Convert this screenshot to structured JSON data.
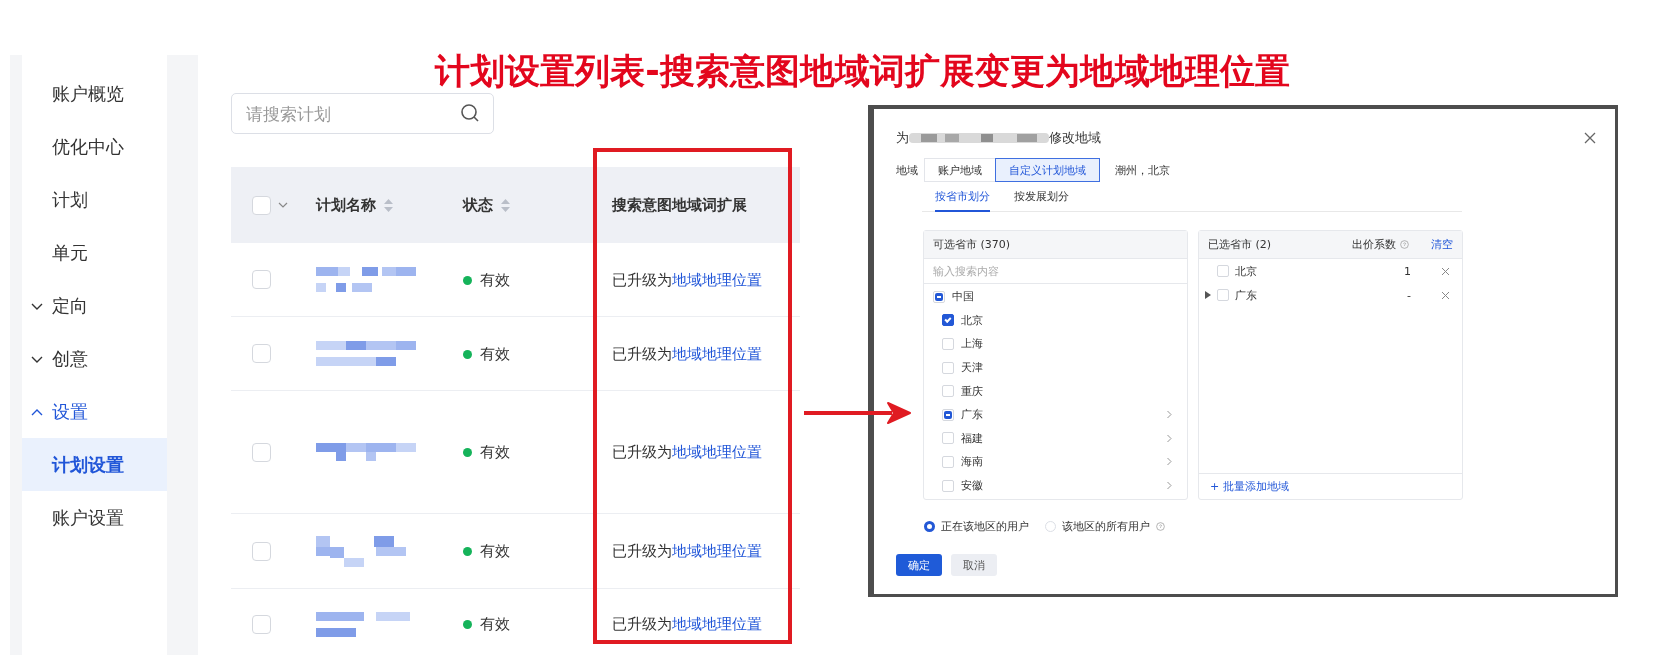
{
  "annotation_title": "计划设置列表-搜索意图地域词扩展变更为地域地理位置",
  "sidebar": {
    "items": [
      {
        "label": "账户概览",
        "kind": "link",
        "selected": false
      },
      {
        "label": "优化中心",
        "kind": "link",
        "selected": false
      },
      {
        "label": "计划",
        "kind": "link",
        "selected": false
      },
      {
        "label": "单元",
        "kind": "link",
        "selected": false
      },
      {
        "label": "定向",
        "kind": "group",
        "expanded": false
      },
      {
        "label": "创意",
        "kind": "group",
        "expanded": false
      },
      {
        "label": "设置",
        "kind": "group",
        "expanded": true,
        "children": [
          {
            "label": "计划设置",
            "kind": "link",
            "selected": true
          },
          {
            "label": "账户设置",
            "kind": "link",
            "selected": false
          }
        ]
      }
    ]
  },
  "search": {
    "placeholder": "请搜索计划"
  },
  "table": {
    "select_all": {
      "checked": false
    },
    "columns": [
      {
        "label": "计划名称",
        "sortable": true
      },
      {
        "label": "状态",
        "sortable": true
      },
      {
        "label": "搜索意图地域词扩展",
        "sortable": false
      }
    ],
    "rows": [
      {
        "checked": false,
        "status": "有效",
        "note": "已升级为",
        "link": "地域地理位置"
      },
      {
        "checked": false,
        "status": "有效",
        "note": "已升级为",
        "link": "地域地理位置"
      },
      {
        "checked": false,
        "status": "有效",
        "note": "已升级为",
        "link": "地域地理位置"
      },
      {
        "checked": false,
        "status": "有效",
        "note": "已升级为",
        "link": "地域地理位置"
      },
      {
        "checked": false,
        "status": "有效",
        "note": "已升级为",
        "link": "地域地理位置"
      }
    ]
  },
  "dialog": {
    "title_prefix": "为",
    "title_suffix": "修改地域",
    "region_label": "地域",
    "region_options": [
      {
        "label": "账户地域",
        "selected": false
      },
      {
        "label": "自定义计划地域",
        "selected": true
      }
    ],
    "region_summary": "潮州，北京",
    "tabs": [
      {
        "label": "按省市划分",
        "selected": true
      },
      {
        "label": "按发展划分",
        "selected": false
      }
    ],
    "available": {
      "title": "可选省市 (370)",
      "search_placeholder": "输入搜索内容",
      "items": [
        {
          "label": "中国",
          "checked": false,
          "indeterminate": true,
          "expandable": false,
          "children": [
            {
              "label": "北京",
              "checked": true,
              "indeterminate": false,
              "expandable": false
            },
            {
              "label": "上海",
              "checked": false,
              "indeterminate": false,
              "expandable": false
            },
            {
              "label": "天津",
              "checked": false,
              "indeterminate": false,
              "expandable": false
            },
            {
              "label": "重庆",
              "checked": false,
              "indeterminate": false,
              "expandable": false
            },
            {
              "label": "广东",
              "checked": false,
              "indeterminate": true,
              "expandable": true
            },
            {
              "label": "福建",
              "checked": false,
              "indeterminate": false,
              "expandable": true
            },
            {
              "label": "海南",
              "checked": false,
              "indeterminate": false,
              "expandable": true
            },
            {
              "label": "安徽",
              "checked": false,
              "indeterminate": false,
              "expandable": true
            }
          ]
        }
      ]
    },
    "chosen": {
      "title": "已选省市 (2)",
      "coef_header": "出价系数",
      "clear": "清空",
      "items": [
        {
          "label": "北京",
          "checked": false,
          "expandable": false,
          "coef": "1"
        },
        {
          "label": "广东",
          "checked": false,
          "expandable": true,
          "coef": "-"
        }
      ],
      "add_link": "+ 批量添加地域"
    },
    "audience": [
      {
        "label": "正在该地区的用户",
        "selected": true,
        "help": false
      },
      {
        "label": "该地区的所有用户",
        "selected": false,
        "help": true
      }
    ],
    "buttons": [
      {
        "label": "确定",
        "kind": "primary"
      },
      {
        "label": "取消",
        "kind": "secondary"
      }
    ]
  }
}
